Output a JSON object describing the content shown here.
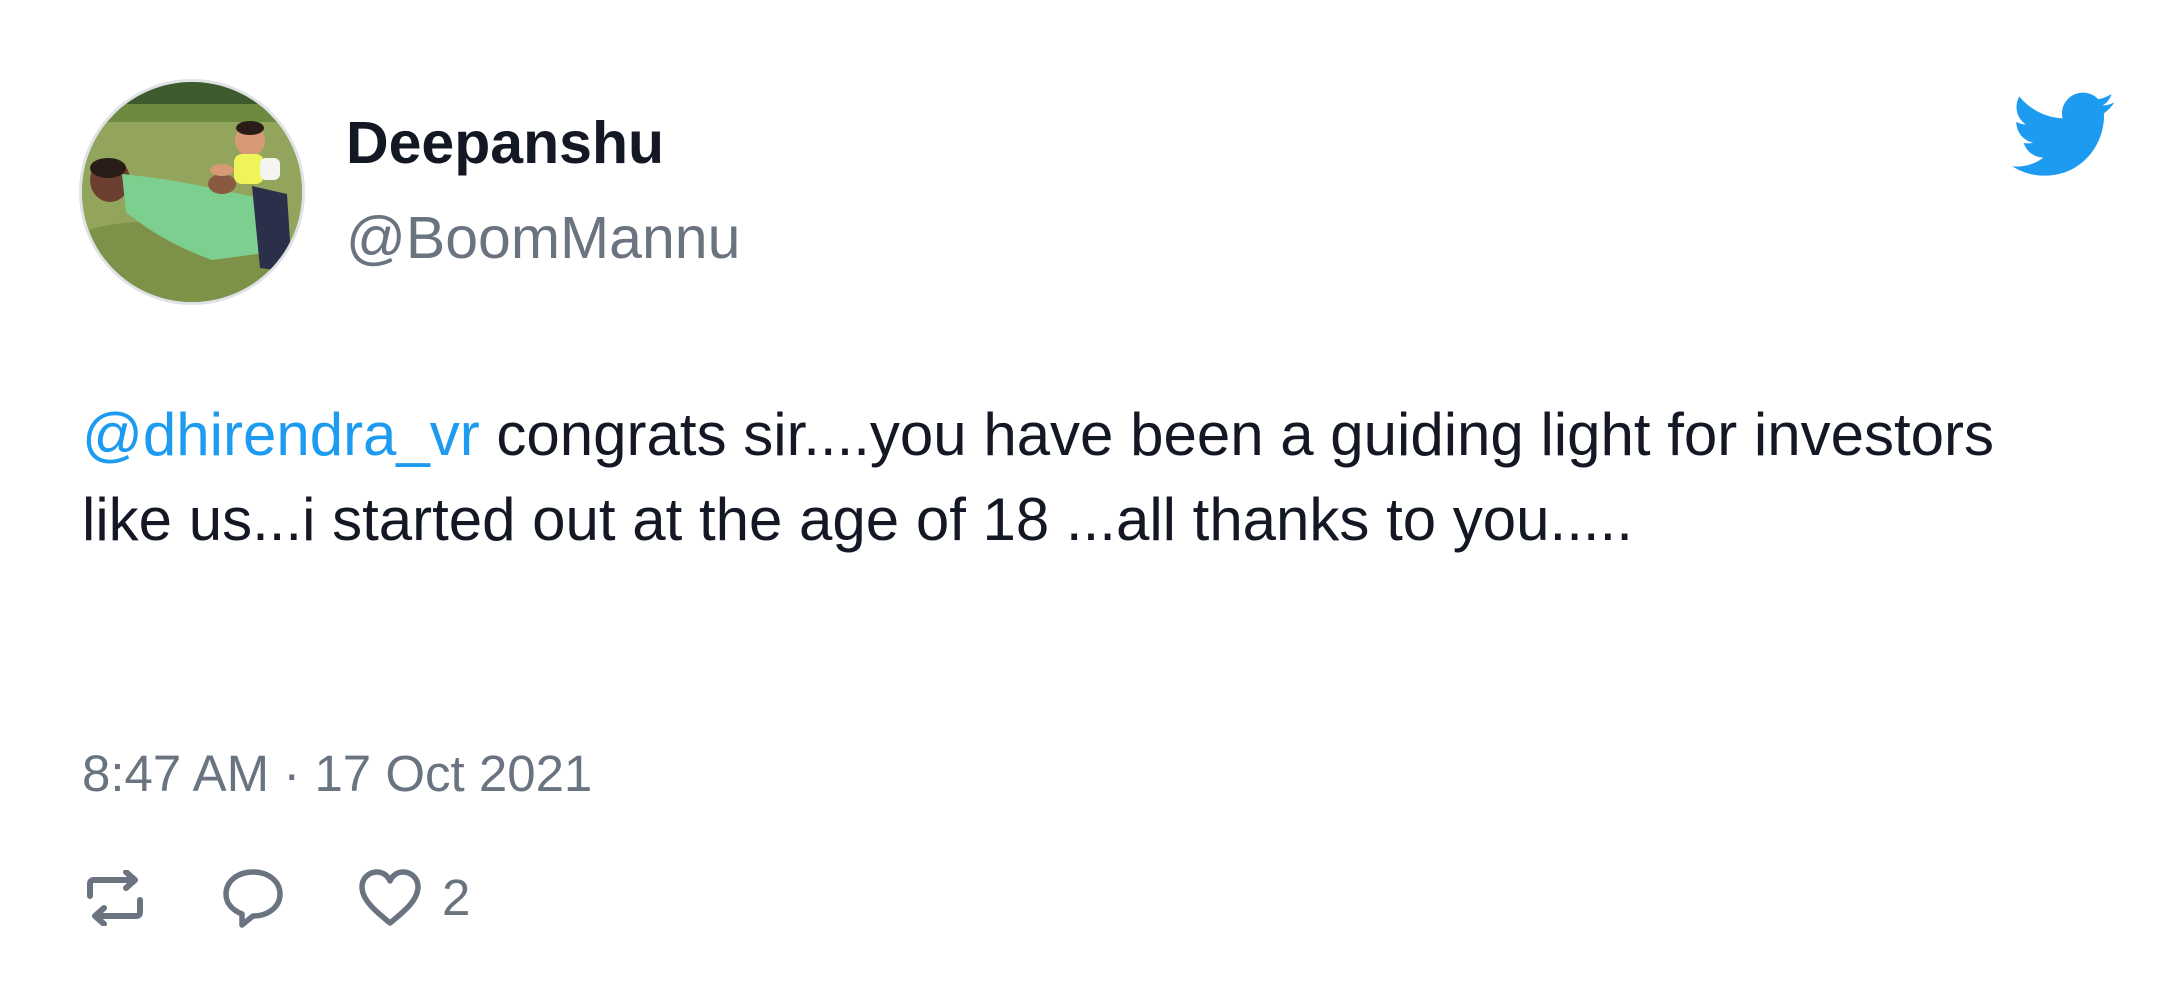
{
  "author": {
    "display_name": "Deepanshu",
    "handle": "@BoomMannu"
  },
  "tweet": {
    "mention": "@dhirendra_vr",
    "text": " congrats sir....you have been a guiding light for investors like us...i started out at the age of 18 ...all thanks to you.....",
    "timestamp": "8:47 AM · 17 Oct 2021"
  },
  "actions": {
    "retweet_icon": "retweet-icon",
    "reply_icon": "reply-icon",
    "like_icon": "heart-icon",
    "like_count": "2"
  },
  "colors": {
    "brand": "#1d9bf0",
    "text": "#141824",
    "muted": "#697480"
  }
}
